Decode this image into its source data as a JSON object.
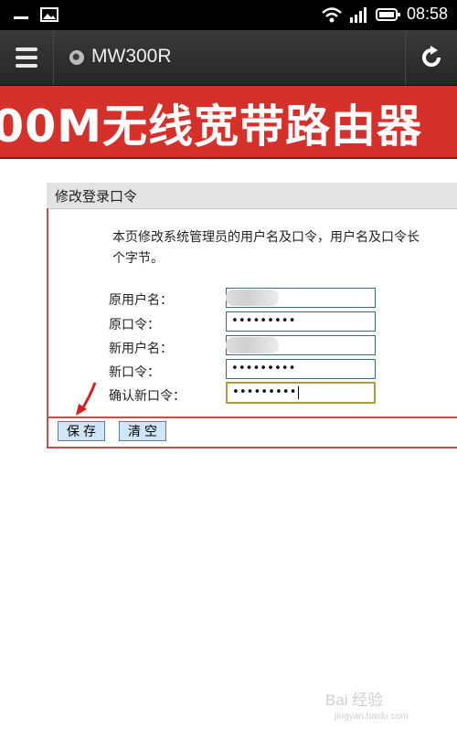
{
  "status_bar": {
    "time": "08:58"
  },
  "browser": {
    "page_title": "MW300R"
  },
  "banner": {
    "text": "00M无线宽带路由器"
  },
  "panel": {
    "title": "修改登录口令",
    "description_line1": "本页修改系统管理员的用户名及口令，用户名及口令长",
    "description_line2": "个字节。",
    "fields": [
      {
        "label": "原用户名：",
        "value": ""
      },
      {
        "label": "原口令：",
        "value": "•••••••••"
      },
      {
        "label": "新用户名：",
        "value": ""
      },
      {
        "label": "新口令：",
        "value": "•••••••••"
      },
      {
        "label": "确认新口令：",
        "value": "•••••••••"
      }
    ],
    "save_label": "保存",
    "clear_label": "清空"
  },
  "watermark": {
    "text": "Bai 经验",
    "url": "jingyan.baidu.com"
  },
  "colors": {
    "banner": "#d6302b",
    "panel_border": "#cf4b4b",
    "button_bg": "#cfe6f7",
    "arrow": "#d42020"
  }
}
